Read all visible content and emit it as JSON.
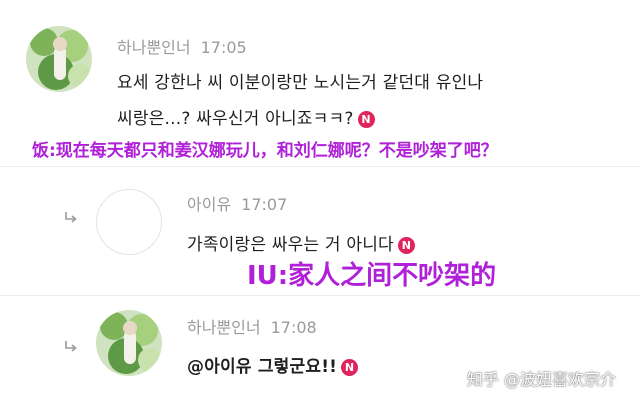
{
  "comments": [
    {
      "author": "하나뿐인너",
      "time": "17:05",
      "line1": "요세 강한나 씨  이분이랑만 노시는거 같던대  유인나",
      "line2": "씨랑은...? 싸우신거 아니죠ㅋㅋ?",
      "badge": "N"
    },
    {
      "author": "아이유",
      "time": "17:07",
      "line1": "가족이랑은 싸우는 거 아니다",
      "badge": "N"
    },
    {
      "author": "하나뿐인너",
      "time": "17:08",
      "line1": "@아이유 그렇군요!!",
      "badge": "N"
    }
  ],
  "captions": {
    "fan": "饭:现在每天都只和姜汉娜玩儿，和刘仁娜呢？不是吵架了吧？",
    "iu": "IU:家人之间不吵架的"
  },
  "watermark": "知乎 @波妞喜欢宗介",
  "colors": {
    "caption": "#b020d8",
    "badge": "#e0245e",
    "meta": "#9a9a9a"
  },
  "icons": [
    "reply-arrow-icon",
    "new-badge-icon"
  ]
}
